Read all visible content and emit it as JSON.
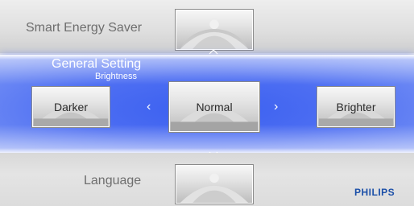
{
  "menu": {
    "prev_item": {
      "label": "Smart Energy Saver"
    },
    "current_section": {
      "title": "General Setting",
      "subtitle": "Brightness"
    },
    "next_item": {
      "label": "Language"
    }
  },
  "brightness": {
    "options": [
      "Darker",
      "Normal",
      "Brighter"
    ],
    "selected": "Normal"
  },
  "icons": {
    "left": "chevron-left-icon",
    "right": "chevron-right-icon",
    "up": "chevron-up-icon",
    "down": "chevron-down-icon"
  },
  "brand": {
    "logo": "PHILIPS"
  },
  "colors": {
    "highlight": "#4a6cf2",
    "logo": "#1b4fa8"
  }
}
